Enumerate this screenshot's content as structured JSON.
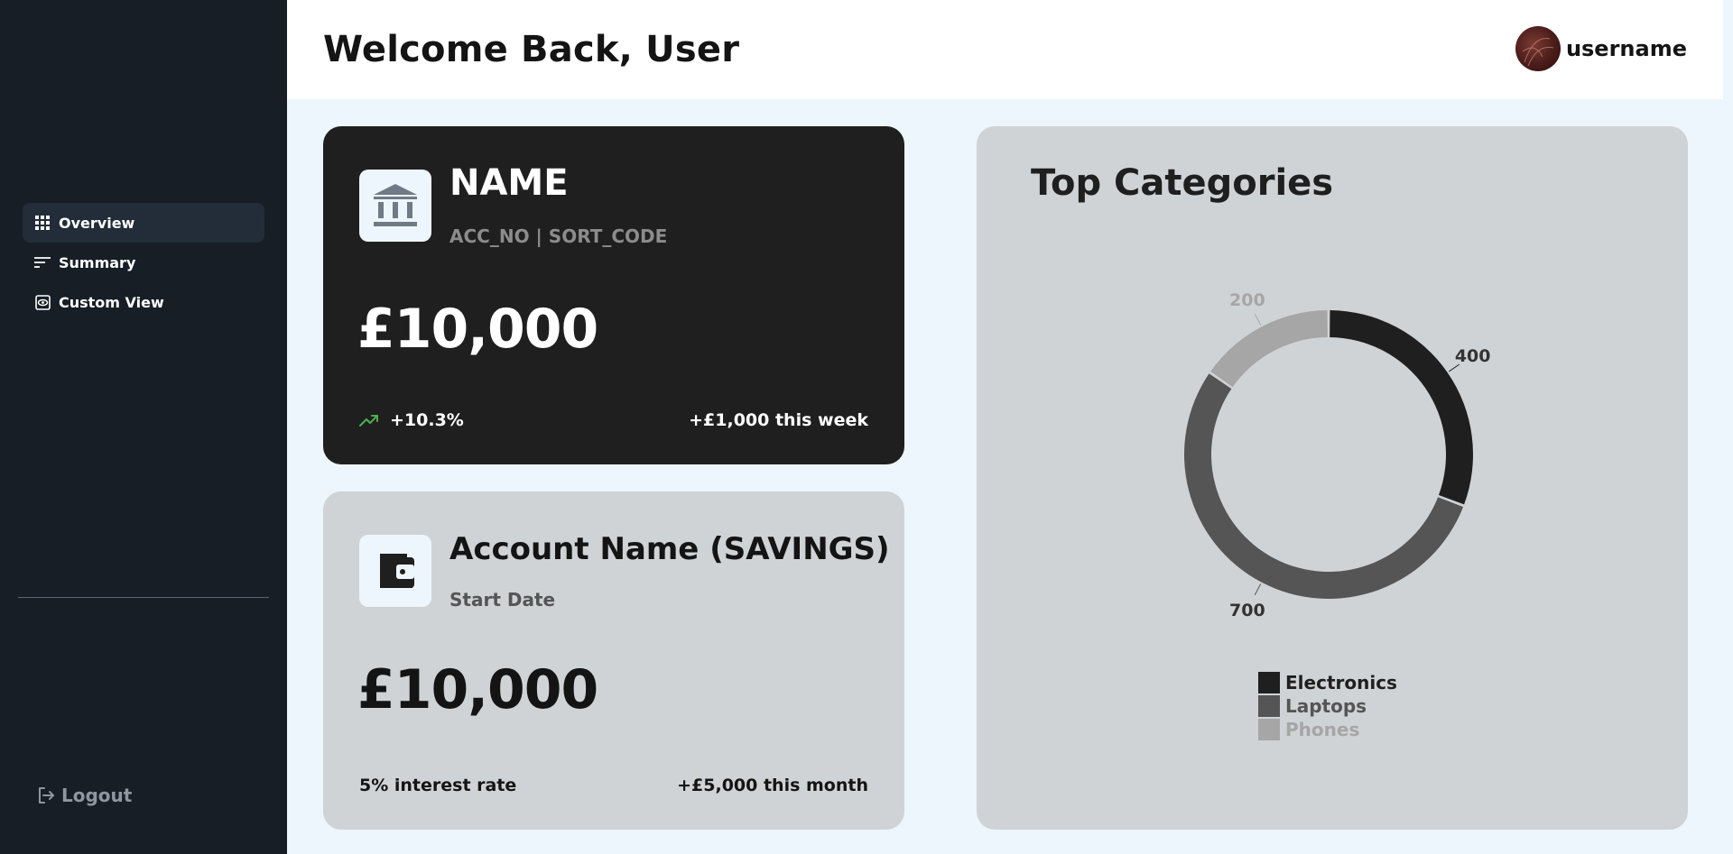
{
  "sidebar": {
    "nav": [
      {
        "label": "Overview",
        "icon": "grid-icon",
        "active": true
      },
      {
        "label": "Summary",
        "icon": "list-icon",
        "active": false
      },
      {
        "label": "Custom View",
        "icon": "eye-icon",
        "active": false
      }
    ],
    "logout_label": "Logout"
  },
  "header": {
    "title": "Welcome Back, User",
    "username": "username"
  },
  "cards": {
    "current": {
      "name": "NAME",
      "sub": "ACC_NO | SORT_CODE",
      "balance": "£10,000",
      "change": "+10.3%",
      "weekly": "+£1,000 this week",
      "icon": "bank-icon",
      "change_color": "#4caf50"
    },
    "savings": {
      "name": "Account Name (SAVINGS)",
      "sub": "Start Date",
      "balance": "£10,000",
      "interest": "5% interest rate",
      "monthly": "+£5,000 this month",
      "icon": "wallet-icon"
    }
  },
  "chart": {
    "title": "Top Categories"
  },
  "chart_data": {
    "type": "pie",
    "title": "Top Categories",
    "donut": true,
    "categories": [
      "Electronics",
      "Laptops",
      "Phones"
    ],
    "values": [
      400,
      700,
      200
    ],
    "colors": [
      "#1f1f1f",
      "#555555",
      "#a6a6a6"
    ],
    "legend": "bottom"
  }
}
